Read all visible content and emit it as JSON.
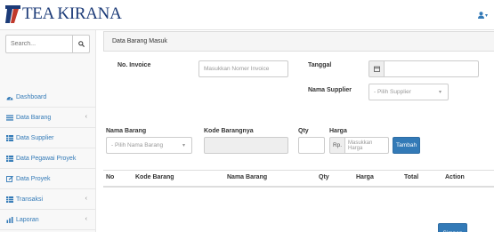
{
  "app": {
    "logo_text": "TEA KIRANA",
    "user_menu_caret": "▾"
  },
  "colors": {
    "brand": "#1c3b78",
    "link": "#337ab7",
    "primary_button": "#337ab7"
  },
  "sidebar": {
    "search_placeholder": "Search...",
    "items": [
      {
        "label": "Dashboard",
        "icon": "dashboard-icon",
        "has_submenu": false
      },
      {
        "label": "Data Barang",
        "icon": "list-icon",
        "has_submenu": true
      },
      {
        "label": "Data Supplier",
        "icon": "table-icon",
        "has_submenu": false
      },
      {
        "label": "Data Pegawai Proyek",
        "icon": "table-icon",
        "has_submenu": false
      },
      {
        "label": "Data Proyek",
        "icon": "edit-icon",
        "has_submenu": false
      },
      {
        "label": "Transaksi",
        "icon": "table-icon",
        "has_submenu": true
      },
      {
        "label": "Laporan",
        "icon": "bar-chart-icon",
        "has_submenu": true
      }
    ]
  },
  "main": {
    "panel_title": "Data Barang Masuk",
    "form": {
      "invoice_label": "No. Invoice",
      "invoice_placeholder": "Masukkan Nomer Invoice",
      "tanggal_label": "Tanggal",
      "supplier_label": "Nama Supplier",
      "supplier_select": "- Pilih Supplier",
      "barang_label": "Nama Barang",
      "barang_select": "- Pilih Nama Barang",
      "kode_label": "Kode Barangnya",
      "qty_label": "Qty",
      "harga_label": "Harga",
      "harga_prefix": "Rp.",
      "harga_placeholder": "Masukkan Harga",
      "tambah_button": "Tambah"
    },
    "table": {
      "columns": [
        "No",
        "Kode Barang",
        "Nama Barang",
        "Qty",
        "Harga",
        "Total",
        "Action"
      ]
    },
    "simpan_button": "Simpan"
  }
}
